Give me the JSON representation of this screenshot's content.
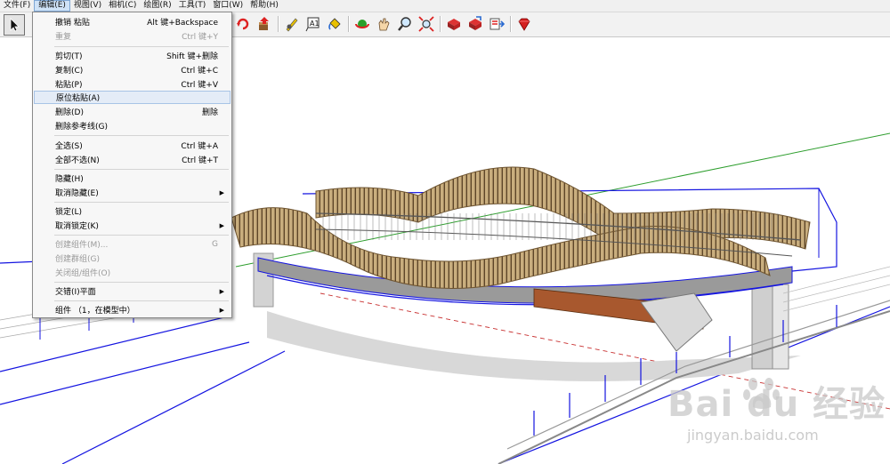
{
  "menubar": {
    "items": [
      {
        "label": "文件(F)"
      },
      {
        "label": "编辑(E)"
      },
      {
        "label": "视图(V)"
      },
      {
        "label": "相机(C)"
      },
      {
        "label": "绘图(R)"
      },
      {
        "label": "工具(T)"
      },
      {
        "label": "窗口(W)"
      },
      {
        "label": "帮助(H)"
      }
    ],
    "active_index": 1
  },
  "toolbar": {
    "icons": [
      "select-icon",
      "rotate-icon",
      "push-pull-icon",
      "tape-measure-icon",
      "text-icon",
      "paint-bucket-icon",
      "orbit-icon",
      "pan-icon",
      "zoom-icon",
      "zoom-extents-icon",
      "get-models-icon",
      "share-model-icon",
      "upload-icon",
      "ruby-icon"
    ]
  },
  "edit_menu": {
    "items": [
      {
        "label": "撤销 粘贴",
        "shortcut": "Alt 键+Backspace",
        "disabled": false
      },
      {
        "label": "重复",
        "shortcut": "Ctrl 键+Y",
        "disabled": true
      },
      {
        "label": "剪切(T)",
        "shortcut": "Shift 键+删除",
        "disabled": false
      },
      {
        "label": "复制(C)",
        "shortcut": "Ctrl 键+C",
        "disabled": false
      },
      {
        "label": "粘贴(P)",
        "shortcut": "Ctrl 键+V",
        "disabled": false
      },
      {
        "label": "原位粘贴(A)",
        "shortcut": "",
        "disabled": false,
        "highlighted": true
      },
      {
        "label": "删除(D)",
        "shortcut": "删除",
        "disabled": false
      },
      {
        "label": "删除参考线(G)",
        "shortcut": "",
        "disabled": false
      },
      {
        "label": "全选(S)",
        "shortcut": "Ctrl 键+A",
        "disabled": false
      },
      {
        "label": "全部不选(N)",
        "shortcut": "Ctrl 键+T",
        "disabled": false
      },
      {
        "label": "隐藏(H)",
        "shortcut": "",
        "disabled": false
      },
      {
        "label": "取消隐藏(E)",
        "shortcut": "",
        "disabled": false,
        "submenu": true
      },
      {
        "label": "锁定(L)",
        "shortcut": "",
        "disabled": false
      },
      {
        "label": "取消锁定(K)",
        "shortcut": "",
        "disabled": false,
        "submenu": true
      },
      {
        "label": "创建组件(M)...",
        "shortcut": "G",
        "disabled": true
      },
      {
        "label": "创建群组(G)",
        "shortcut": "",
        "disabled": true
      },
      {
        "label": "关闭组/组件(O)",
        "shortcut": "",
        "disabled": true
      },
      {
        "label": "交错(I)平面",
        "shortcut": "",
        "disabled": false,
        "submenu": true
      },
      {
        "label": "组件 （1，在模型中）",
        "shortcut": "",
        "disabled": false,
        "submenu": true
      }
    ]
  },
  "watermark": {
    "brand": "Bai du 经验",
    "url": "jingyan.baidu.com"
  },
  "colors": {
    "menubar_bg": "#f0f0f0",
    "menu_highlight": "#e4ecf7",
    "disabled_text": "#9a9a9a",
    "axis_green": "#2e9e2e",
    "axis_red": "#c83030",
    "selection_blue": "#1414e0",
    "wood": "#b59a6a"
  }
}
